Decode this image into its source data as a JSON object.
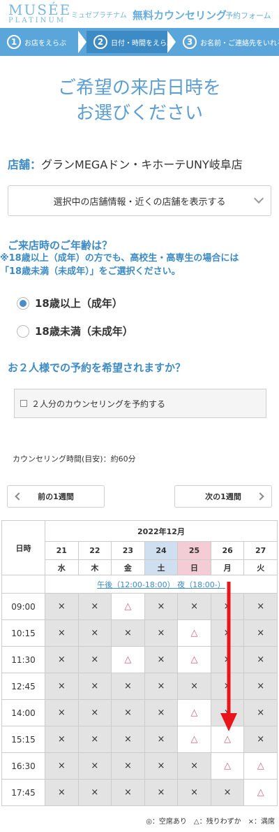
{
  "header": {
    "logo_main": "MUSÉE",
    "logo_sub": "PLATINUM",
    "brand_kana": "ミュゼプラチナム",
    "title": "無料カウンセリング",
    "subtitle": "予約フォーム"
  },
  "steps": [
    {
      "num": "1",
      "label": "お店をえらぶ"
    },
    {
      "num": "2",
      "label": "日付・時間をえらぶ"
    },
    {
      "num": "3",
      "label": "お名前・ご連絡先をいれる"
    }
  ],
  "page_title_line1": "ご希望の来店日時を",
  "page_title_line2": "お選びください",
  "store": {
    "label": "店舗：",
    "name": "グランMEGAドン・キホーテUNY岐阜店"
  },
  "store_toggle": "選択中の店舗情報・近くの店舗を表示する",
  "age": {
    "question": "ご来店時のご年齢は？",
    "note_line1": "※18歳以上（成年）の方でも、高校生・高専生の場合には",
    "note_line2": "「18歳未満（未成年）」をご選択ください。",
    "options": [
      "18歳以上（成年）",
      "18歳未満（未成年）"
    ]
  },
  "pair": {
    "question": "お２人様での予約を希望されますか？",
    "option": "２人分のカウンセリングを予約する"
  },
  "duration": "カウンセリング時間(目安)：約60分",
  "week_prev": "前の1週間",
  "week_next": "次の1週間",
  "calendar": {
    "corner": "日時",
    "month": "2022年12月",
    "dates": [
      "21",
      "22",
      "23",
      "24",
      "25",
      "26",
      "27"
    ],
    "dows": [
      "水",
      "木",
      "金",
      "土",
      "日",
      "月",
      "火"
    ],
    "period_pm": "午後（12:00-18:00）",
    "period_night": "夜（18:00-）",
    "times": [
      "09:00",
      "10:15",
      "11:30",
      "12:45",
      "14:00",
      "15:15",
      "16:30",
      "17:45"
    ],
    "slots": [
      [
        "×",
        "×",
        "△",
        "×",
        "×",
        "×",
        "×"
      ],
      [
        "×",
        "×",
        "×",
        "×",
        "△",
        "×",
        "×"
      ],
      [
        "×",
        "×",
        "△",
        "×",
        "△",
        "×",
        "×"
      ],
      [
        "×",
        "×",
        "×",
        "×",
        "×",
        "×",
        "×"
      ],
      [
        "×",
        "×",
        "×",
        "×",
        "△",
        "×",
        "×"
      ],
      [
        "×",
        "×",
        "×",
        "×",
        "△",
        "△",
        "×"
      ],
      [
        "×",
        "×",
        "×",
        "×",
        "×",
        "△",
        "△"
      ],
      [
        "×",
        "×",
        "×",
        "×",
        "×",
        "×",
        "△"
      ]
    ]
  },
  "legend": "◎：空席あり　△：残りわずか　×：満席",
  "colors": {
    "brand": "#5aa6da",
    "accent": "#3d8bc4",
    "arrow": "#e8161b",
    "triangle": "#d06080"
  }
}
